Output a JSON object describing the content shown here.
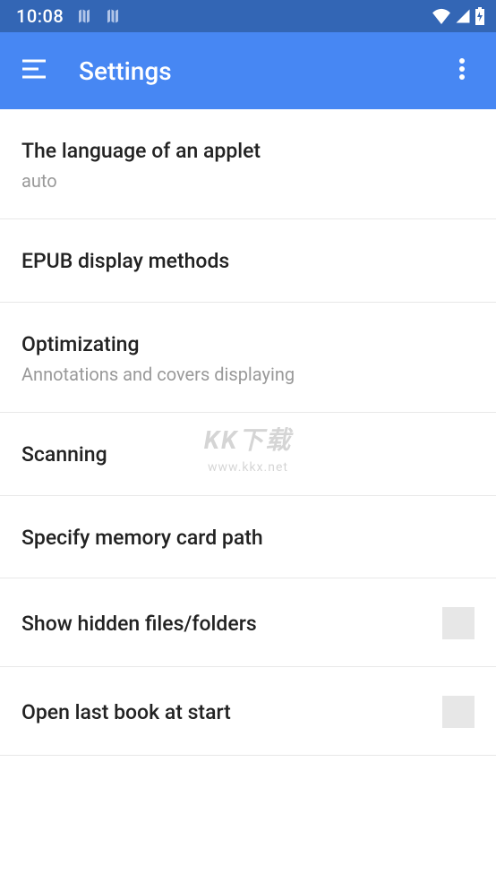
{
  "statusBar": {
    "time": "10:08"
  },
  "appBar": {
    "title": "Settings"
  },
  "settings": [
    {
      "title": "The language of an applet",
      "subtitle": "auto",
      "hasCheckbox": false
    },
    {
      "title": "EPUB display methods",
      "subtitle": "",
      "hasCheckbox": false
    },
    {
      "title": "Optimizating",
      "subtitle": "Annotations and covers displaying",
      "hasCheckbox": false
    },
    {
      "title": "Scanning",
      "subtitle": "",
      "hasCheckbox": false
    },
    {
      "title": "Specify memory card path",
      "subtitle": "",
      "hasCheckbox": false
    },
    {
      "title": "Show hidden files/folders",
      "subtitle": "",
      "hasCheckbox": true
    },
    {
      "title": "Open last book at start",
      "subtitle": "",
      "hasCheckbox": true
    }
  ],
  "watermark": {
    "main": "KK下载",
    "sub": "www.kkx.net"
  }
}
